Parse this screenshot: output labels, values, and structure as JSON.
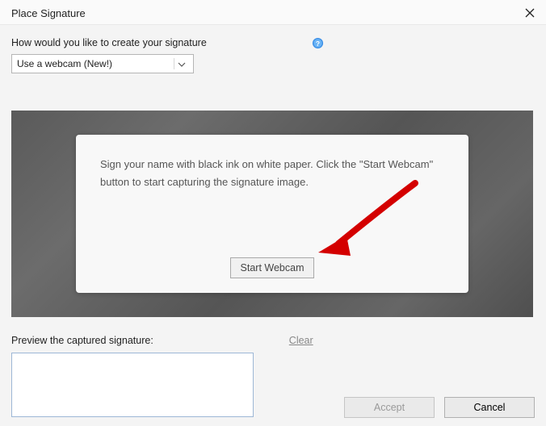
{
  "window": {
    "title": "Place Signature"
  },
  "form": {
    "prompt": "How would you like to create your signature",
    "dropdown_value": "Use a webcam (New!)"
  },
  "panel": {
    "instruction": "Sign your name with black ink on white paper. Click the \"Start Webcam\" button to start capturing the signature image.",
    "start_button": "Start Webcam"
  },
  "preview": {
    "label": "Preview the captured signature:",
    "clear": "Clear"
  },
  "buttons": {
    "accept": "Accept",
    "cancel": "Cancel"
  }
}
